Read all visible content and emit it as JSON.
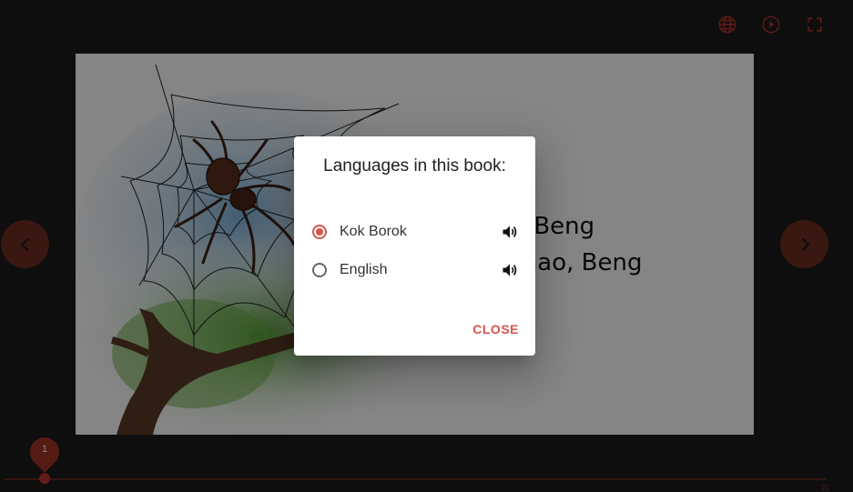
{
  "page": {
    "story_lines": [
      "Beng, Beng",
      "g besnao, Beng"
    ]
  },
  "dialog": {
    "title": "Languages in this book:",
    "languages": [
      {
        "label": "Kok Borok",
        "selected": true
      },
      {
        "label": "English",
        "selected": false
      }
    ],
    "close_label": "CLOSE"
  },
  "slider": {
    "current_page": "1",
    "max_page": "21"
  },
  "colors": {
    "accent": "#d9534f",
    "background": "#1b1b1b"
  },
  "icons": [
    "globe-icon",
    "play-icon",
    "fullscreen-icon",
    "chevron-left-icon",
    "chevron-right-icon",
    "speaker-icon"
  ]
}
